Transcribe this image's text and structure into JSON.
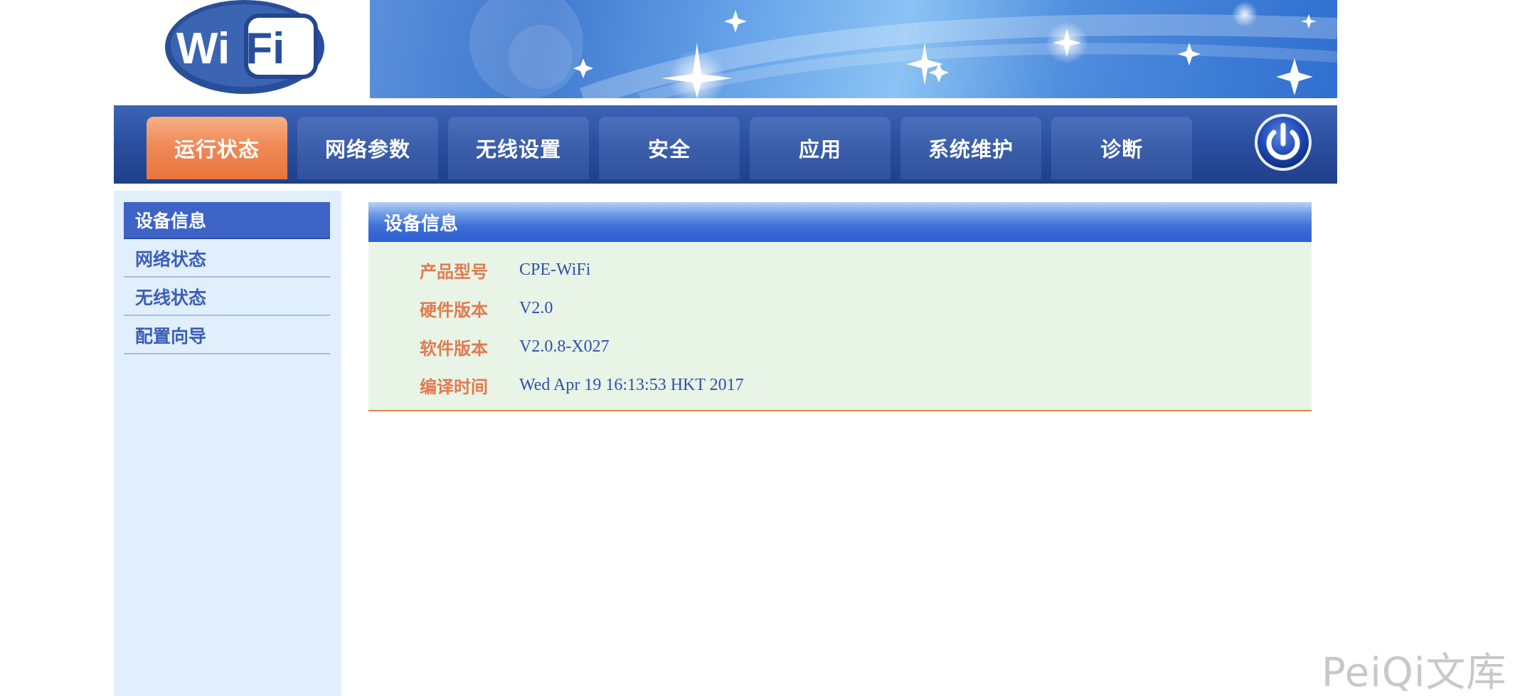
{
  "header": {
    "logo_text": "WiFi"
  },
  "nav": {
    "tabs": [
      {
        "label": "运行状态",
        "active": true
      },
      {
        "label": "网络参数",
        "active": false
      },
      {
        "label": "无线设置",
        "active": false
      },
      {
        "label": "安全",
        "active": false
      },
      {
        "label": "应用",
        "active": false
      },
      {
        "label": "系统维护",
        "active": false
      },
      {
        "label": "诊断",
        "active": false
      }
    ],
    "power_icon": "power-icon"
  },
  "sidebar": {
    "items": [
      {
        "label": "设备信息",
        "active": true
      },
      {
        "label": "网络状态",
        "active": false
      },
      {
        "label": "无线状态",
        "active": false
      },
      {
        "label": "配置向导",
        "active": false
      }
    ]
  },
  "main": {
    "section_title": "设备信息",
    "rows": [
      {
        "label": "产品型号",
        "value": "CPE-WiFi"
      },
      {
        "label": "硬件版本",
        "value": "V2.0"
      },
      {
        "label": "软件版本",
        "value": "V2.0.8-X027"
      },
      {
        "label": "编译时间",
        "value": "Wed Apr 19 16:13:53 HKT 2017"
      }
    ]
  },
  "watermark": "PeiQi文库",
  "colors": {
    "nav_bg": "#2b4f9f",
    "tab_active": "#f08a58",
    "sidebar_bg": "#e1eefc",
    "sidebar_active": "#3d63c7",
    "panel_bg": "#e8f4e6",
    "label_color": "#e07a4f",
    "value_color": "#2f50b0"
  }
}
